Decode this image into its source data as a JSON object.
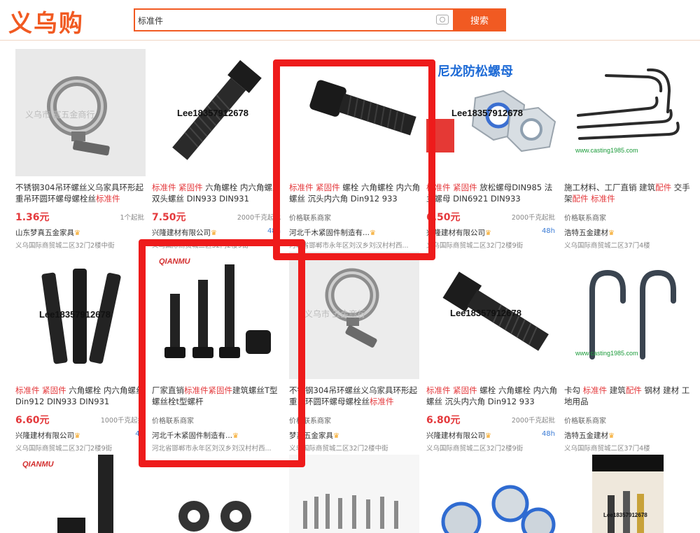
{
  "header": {
    "logo": "义乌购",
    "search_value": "标准件",
    "search_button": "搜索"
  },
  "cards": [
    {
      "title": "不锈钢304吊环螺丝义乌家具环形起重吊环圆环螺母螺栓丝标准件",
      "price": "1.36元",
      "moq": "1个起批",
      "seller": "山东梦真五金家具",
      "addr": "义乌国际商贸城二区32门2楼中街",
      "watermark": "义乌市 富五金商行"
    },
    {
      "title": "标准件 紧固件 六角螺栓 内六角螺丝 双头螺丝 DIN933 DIN931",
      "price": "7.50元",
      "moq": "2000千克起批",
      "seller": "兴隆建材有限公司",
      "badge": "48h",
      "addr": "义乌国际商贸城二区32门2楼9街",
      "watermark": "Lee18357912678"
    },
    {
      "title": "标准件 紧固件 螺栓 六角螺栓 内六角螺丝 沉头内六角 Din912 933",
      "price": "价格联系商家",
      "moq": "",
      "seller": "河北千木紧固件制造有...",
      "addr": "河北省邯郸市永年区刘汉乡刘汉村村西..."
    },
    {
      "title": "标准件 紧固件 放松螺母DIN985 法兰螺母 DIN6921 DIN933",
      "price": "6.50元",
      "moq": "2000千克起批",
      "seller": "兴隆建材有限公司",
      "badge": "48h",
      "addr": "义乌国际商贸城二区32门2楼9街",
      "watermark": "Lee18357912678",
      "banner": "尼龙防松螺母"
    },
    {
      "title": "施工材料、工厂直销 建筑配件 交手架配件 标准件",
      "price": "价格联系商家",
      "moq": "",
      "seller": "浩特五金建材",
      "addr": "义乌国际商贸城二区37门4楼",
      "watermark": "www.casting1985.com"
    },
    {
      "title": "标准件 紧固件 六角螺栓 内六角螺丝 Din912 DIN933 DIN931",
      "price": "6.60元",
      "moq": "1000千克起批",
      "seller": "兴隆建材有限公司",
      "badge": "48",
      "addr": "义乌国际商贸城二区32门2楼9街",
      "watermark": "Lee18357912678"
    },
    {
      "title": "厂家直销标准件紧固件建筑螺丝T型螺丝栓t型螺杆",
      "price": "价格联系商家",
      "moq": "",
      "seller": "河北千木紧固件制造有...",
      "addr": "河北省邯郸市永年区刘汉乡刘汉村村西...",
      "brand": "QIANMU"
    },
    {
      "title": "不锈钢304吊环螺丝义乌家具环形起重吊环圆环螺母螺栓丝标准件",
      "price": "价格联系商家",
      "moq": "",
      "seller": "梦真五金家具",
      "addr": "义乌国际商贸城二区32门2楼中街",
      "watermark": "义乌市 五金商行"
    },
    {
      "title": "标准件 紧固件 螺栓 六角螺栓 内六角螺丝 沉头内六角 Din912 933",
      "price": "6.80元",
      "moq": "2000千克起批",
      "seller": "兴隆建材有限公司",
      "badge": "48h",
      "addr": "义乌国际商贸城二区32门2楼9街",
      "watermark": "Lee18357912678"
    },
    {
      "title": "卡勾 标准件 建筑配件 钢材 建材 工地用品",
      "price": "价格联系商家",
      "moq": "",
      "seller": "浩特五金建材",
      "addr": "义乌国际商贸城二区37门4楼",
      "watermark": "www.casting1985.com"
    }
  ],
  "row3": {
    "brand": "QIANMU",
    "watermark": "Lee18357912678"
  },
  "colors": {
    "accent": "#f15a22",
    "highlight": "#e4393c",
    "annotation": "#ee1b1b"
  }
}
